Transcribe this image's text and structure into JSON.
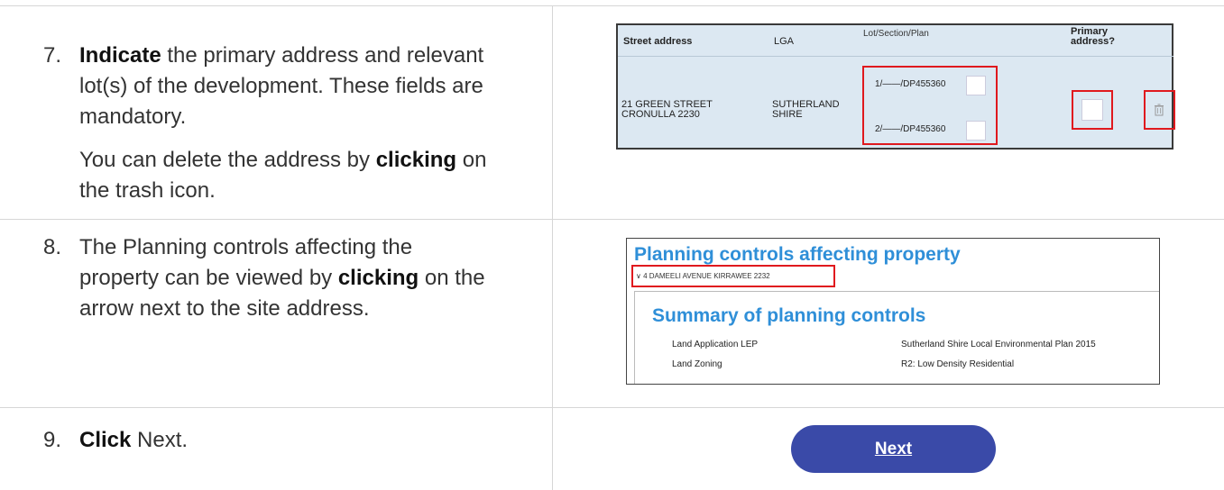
{
  "steps": [
    {
      "number": "7.",
      "bold": "Indicate",
      "text": " the primary address and relevant lot(s) of the development. These fields are mandatory.",
      "line1_rest": " the primary address and relevant",
      "line2": "lot(s) of the development. These fields are",
      "line3": "mandatory.",
      "para2_pre": "You can delete the address by ",
      "para2_bold": "clicking",
      "para2_post": " on",
      "para2_line2": "the trash icon."
    },
    {
      "number": "8.",
      "line1": "The Planning controls affecting the",
      "line2_pre": "property can be viewed by ",
      "line2_bold": "clicking",
      "line2_post": " on the",
      "line3": "arrow next to the site address."
    },
    {
      "number": "9.",
      "bold": "Click",
      "text": " Next."
    }
  ],
  "address_table": {
    "headers": {
      "street": "Street address",
      "lga": "LGA",
      "lot": "Lot/Section/Plan",
      "primary_line1": "Primary",
      "primary_line2": "address?"
    },
    "row": {
      "street_line1": "21 GREEN STREET",
      "street_line2": "CRONULLA 2230",
      "lga_line1": "SUTHERLAND",
      "lga_line2": "SHIRE",
      "lots": [
        "1/——/DP455360",
        "2/——/DP455360"
      ]
    },
    "icons": {
      "trash": "trash-icon"
    }
  },
  "planning_panel": {
    "title": "Planning controls affecting property",
    "address": "4 DAMEELI AVENUE KIRRAWEE 2232",
    "summary_title": "Summary of planning controls",
    "rows": [
      {
        "label": "Land Application LEP",
        "value": "Sutherland Shire Local Environmental Plan 2015"
      },
      {
        "label": "Land Zoning",
        "value": "R2: Low Density Residential"
      }
    ]
  },
  "next_button": {
    "label": "Next",
    "color": "#3a4aa8"
  },
  "colors": {
    "highlight": "#e0191e",
    "title_blue": "#2f8fd8",
    "panel_bg": "#dce8f2"
  }
}
